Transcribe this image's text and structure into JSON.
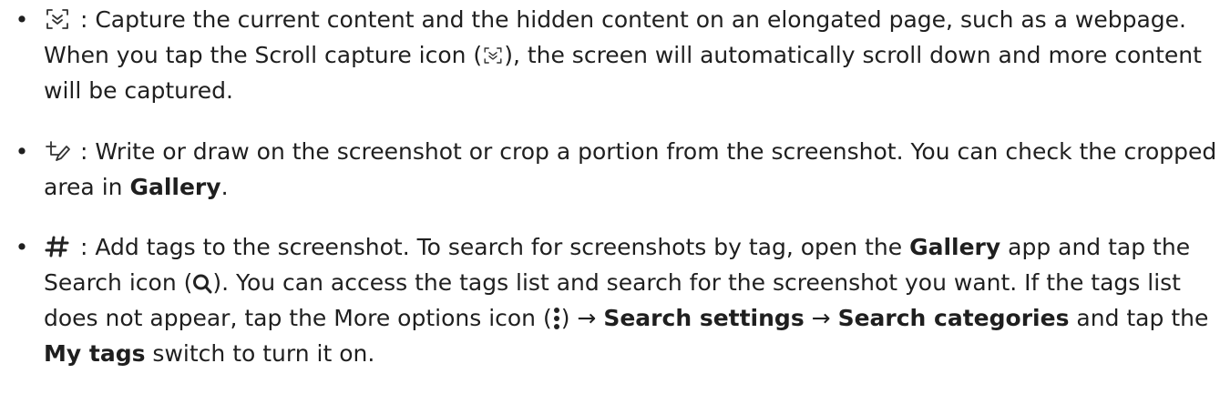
{
  "items": [
    {
      "icon": "scroll-capture-icon",
      "sep": " : ",
      "text_a": "Capture the current content and the hidden content on an elongated page, such as a webpage. When you tap the Scroll capture icon (",
      "text_b": "), the screen will automatically scroll down and more content will be captured."
    },
    {
      "icon": "draw-crop-icon",
      "sep": " : ",
      "text_a": "Write or draw on the screenshot or crop a portion from the screenshot. You can check the cropped area in ",
      "bold_gallery": "Gallery",
      "text_b": "."
    },
    {
      "icon": "hashtag-icon",
      "sep": " : ",
      "text_a": "Add tags to the screenshot. To search for screenshots by tag, open the ",
      "bold_gallery": "Gallery",
      "text_b": " app and tap the Search icon (",
      "text_c": "). You can access the tags list and search for the screenshot you want. If the tags list does not appear, tap the More options icon (",
      "text_d": ") → ",
      "bold_search_settings": "Search settings",
      "arrow": " → ",
      "bold_search_categories": "Search categories",
      "text_e": " and tap the ",
      "bold_my_tags": "My tags",
      "text_f": " switch to turn it on."
    }
  ],
  "bullet_char": "•"
}
